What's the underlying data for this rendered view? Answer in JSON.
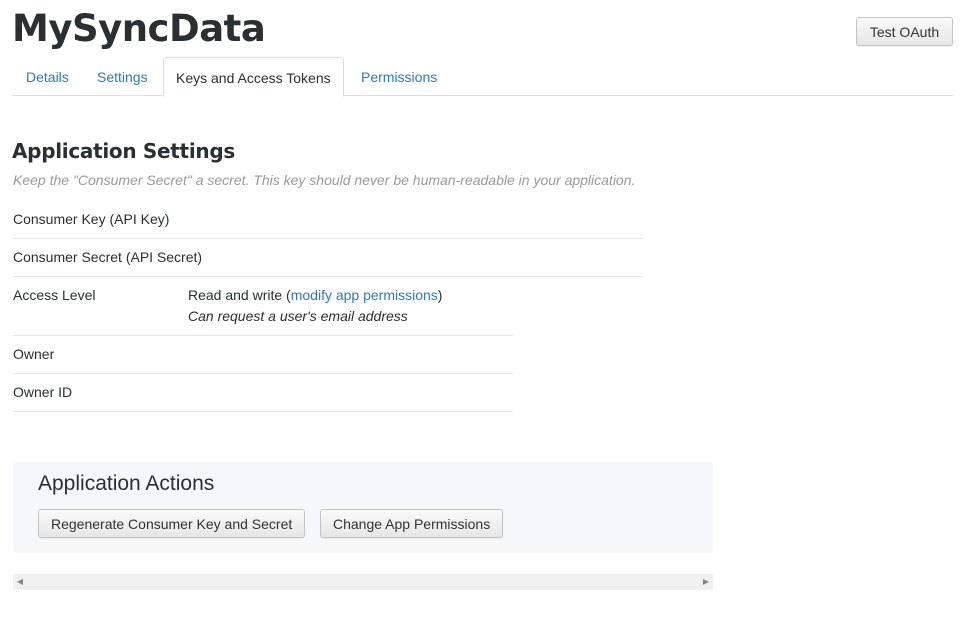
{
  "app": {
    "title": "MySyncData"
  },
  "header": {
    "test_oauth_label": "Test OAuth"
  },
  "tabs": [
    {
      "label": "Details",
      "active": false
    },
    {
      "label": "Settings",
      "active": false
    },
    {
      "label": "Keys and Access Tokens",
      "active": true
    },
    {
      "label": "Permissions",
      "active": false
    }
  ],
  "settings": {
    "heading": "Application Settings",
    "note": "Keep the \"Consumer Secret\" a secret. This key should never be human-readable in your application.",
    "rows": {
      "consumer_key": {
        "label": "Consumer Key (API Key)"
      },
      "consumer_secret": {
        "label": "Consumer Secret (API Secret)"
      },
      "access_level": {
        "label": "Access Level",
        "value_prefix": "Read and write (",
        "link": "modify app permissions",
        "value_suffix": ")",
        "note": "Can request a user's email address"
      },
      "owner": {
        "label": "Owner"
      },
      "owner_id": {
        "label": "Owner ID"
      }
    }
  },
  "actions": {
    "heading": "Application Actions",
    "regenerate_label": "Regenerate Consumer Key and Secret",
    "change_permissions_label": "Change App Permissions"
  },
  "colors": {
    "link": "#2b7bb9",
    "text": "#292f33",
    "muted": "#999999",
    "panel_bg": "#f5f8fa"
  },
  "icons": {
    "scroll_left": "scroll-left-arrow-icon",
    "scroll_right": "scroll-right-arrow-icon"
  }
}
